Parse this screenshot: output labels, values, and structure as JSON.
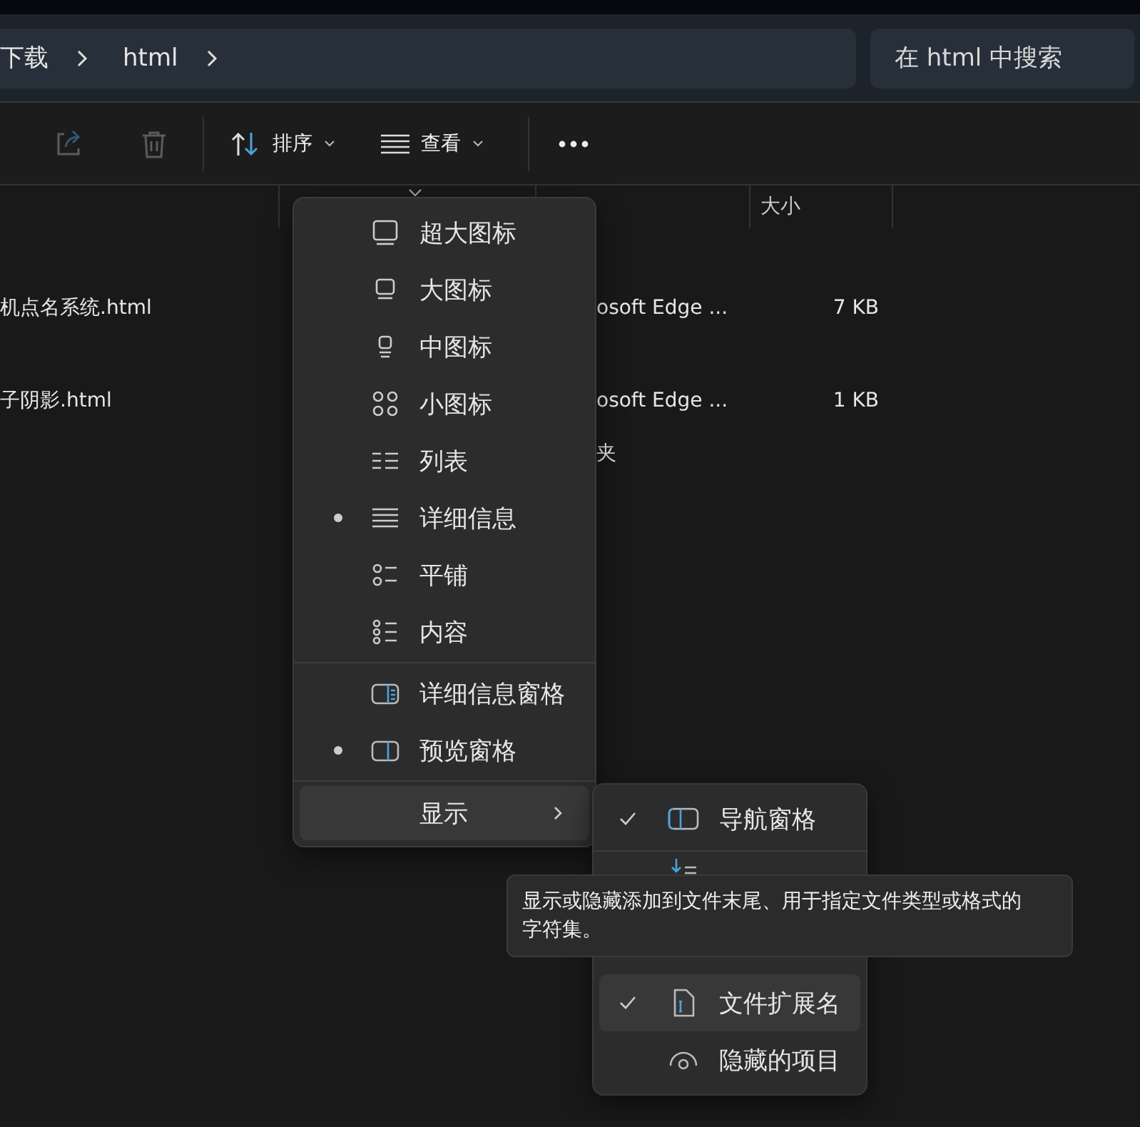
{
  "breadcrumb": [
    {
      "label": "下载"
    },
    {
      "label": "html"
    }
  ],
  "search": {
    "placeholder": "在 html 中搜索"
  },
  "toolbar": {
    "actions": [
      {
        "kind": "share",
        "disabled": true
      },
      {
        "kind": "delete",
        "disabled": true
      }
    ],
    "sort": {
      "label": "排序"
    },
    "view": {
      "label": "查看"
    }
  },
  "table": {
    "size_heading": "大小",
    "rows": [
      {
        "name": "机点名系统.html",
        "type": "osoft Edge ...",
        "size": "7 KB"
      },
      {
        "name": "子阴影.html",
        "type": "osoft Edge ...",
        "size": "1 KB"
      },
      {
        "type": "夹"
      }
    ]
  },
  "view_menu": {
    "layouts": [
      {
        "label": "超大图标",
        "kind": "xl",
        "selected": false
      },
      {
        "label": "大图标",
        "kind": "large",
        "selected": false
      },
      {
        "label": "中图标",
        "kind": "medium",
        "selected": false
      },
      {
        "label": "小图标",
        "kind": "small",
        "selected": false
      },
      {
        "label": "列表",
        "kind": "list",
        "selected": false
      },
      {
        "label": "详细信息",
        "kind": "details",
        "selected": true
      },
      {
        "label": "平铺",
        "kind": "tiles",
        "selected": false
      },
      {
        "label": "内容",
        "kind": "content",
        "selected": false
      }
    ],
    "panes": [
      {
        "label": "详细信息窗格",
        "kind": "details_pane",
        "selected": false
      },
      {
        "label": "预览窗格",
        "kind": "preview_pane",
        "selected": true
      }
    ],
    "show": {
      "label": "显示"
    }
  },
  "show_menu": [
    {
      "label": "导航窗格",
      "kind": "nav",
      "checked": true
    },
    {
      "kind": "compact"
    },
    {
      "label": "文件扩展名",
      "kind": "ext",
      "checked": true,
      "hovered": true
    },
    {
      "label": "隐藏的项目",
      "kind": "hidden",
      "checked": false
    }
  ],
  "tooltip": {
    "text": "显示或隐藏添加到文件末尾、用于指定文件类型或格式的字符集。"
  }
}
